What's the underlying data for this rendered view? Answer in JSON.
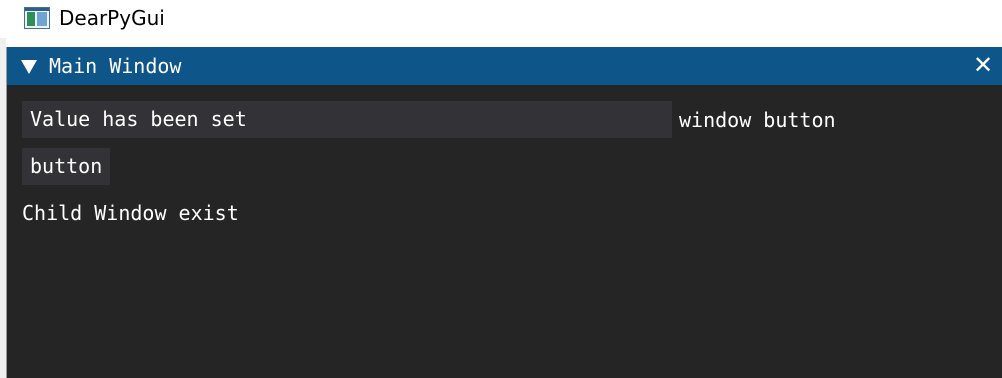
{
  "app": {
    "window_title": "DearPyGui"
  },
  "main_window": {
    "title": "Main Window",
    "close_glyph": "✕",
    "input": {
      "value": "Value has been set",
      "label": "window button"
    },
    "button_label": "button",
    "status_text": "Child Window exist"
  },
  "colors": {
    "titlebar": "#0e5589",
    "window_bg": "#252526",
    "frame_bg": "#333337",
    "text": "#ffffff"
  },
  "icons": {
    "app_icon": "window-app-icon",
    "collapse": "triangle-down-icon",
    "close": "close-icon"
  }
}
